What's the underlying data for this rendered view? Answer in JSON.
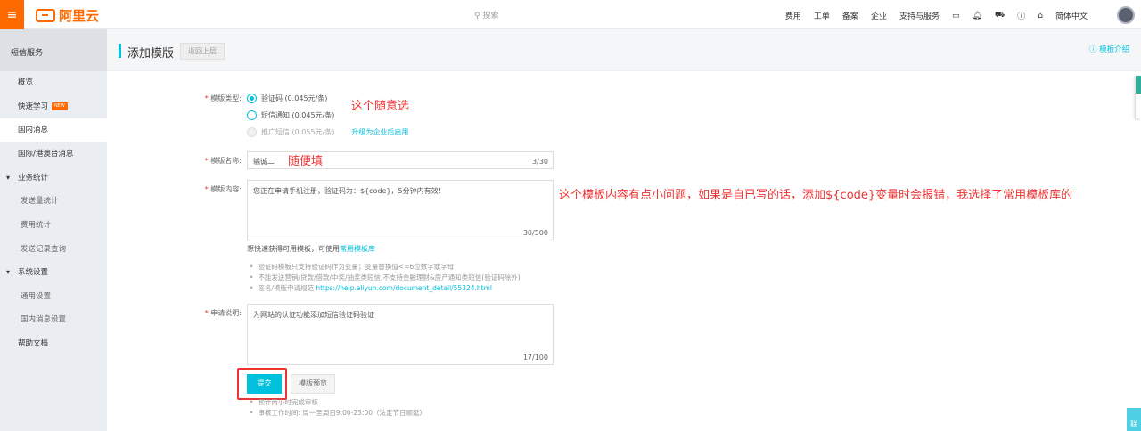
{
  "topbar": {
    "logo": "阿里云",
    "search_placeholder": "搜索",
    "nav": [
      "费用",
      "工单",
      "备案",
      "企业",
      "支持与服务"
    ],
    "language": "简体中文"
  },
  "sidebar": {
    "header": "短信服务",
    "items": [
      {
        "label": "概览"
      },
      {
        "label": "快速学习",
        "badge": "NEW"
      },
      {
        "label": "国内消息"
      },
      {
        "label": "国际/港澳台消息"
      },
      {
        "label": "业务统计"
      },
      {
        "label": "发送量统计"
      },
      {
        "label": "费用统计"
      },
      {
        "label": "发送记录查询"
      },
      {
        "label": "系统设置"
      },
      {
        "label": "通用设置"
      },
      {
        "label": "国内消息设置"
      },
      {
        "label": "帮助文档"
      }
    ]
  },
  "page": {
    "title": "添加模版",
    "back": "返回上层",
    "help": "模板介绍"
  },
  "form": {
    "type_label": "模版类型:",
    "types": [
      {
        "label": "验证码 (0.045元/条)"
      },
      {
        "label": "短信通知 (0.045元/条)"
      },
      {
        "label": "推广短信 (0.055元/条)"
      }
    ],
    "upgrade_link": "升级为企业后启用",
    "name_label": "模版名称:",
    "name_value": "输诚二",
    "name_count": "3/30",
    "content_label": "模版内容:",
    "content_value": "您正在申请手机注册，验证码为：${code}，5分钟内有效！",
    "content_count": "30/500",
    "quick_prefix": "想快速获得可用模板，可使用",
    "quick_link": "常用模板库",
    "tips": [
      "验证码模板只支持验证码作为变量；变量替换值<=6位数字或字母",
      "不能发送营销/贷款/借款/中奖/抽奖类短信,不支持金融理财&房产通知类短信(验证码除外)",
      "签名/模版申请规范 "
    ],
    "tips_link": "https://help.aliyun.com/document_detail/55324.html",
    "desc_label": "申请说明:",
    "desc_value": "为网站的认证功能添加短信验证码验证",
    "desc_count": "17/100",
    "submit": "提交",
    "preview": "模版预览",
    "footer_tips": [
      "预计两小时完成审核",
      "审核工作时间: 周一至周日9:00-23:00（法定节日顺延）"
    ]
  },
  "annotations": [
    "这个随意选",
    "随便填",
    "这个模板内容有点小问题，如果是自已写的话，添加${code}变量时会报错，我选择了常用模板库的"
  ],
  "contact": "联"
}
